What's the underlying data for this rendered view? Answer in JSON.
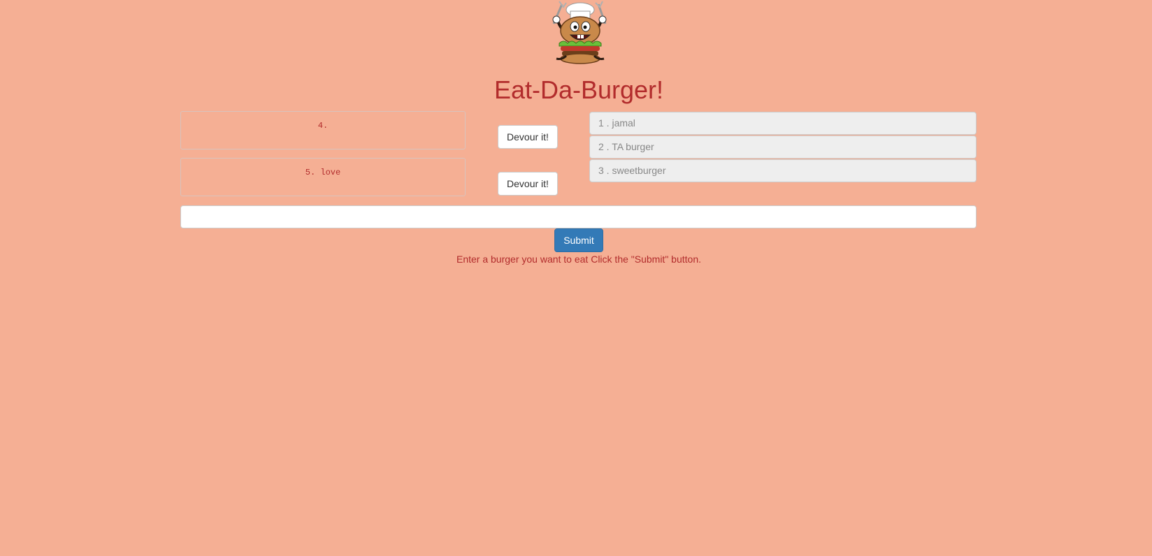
{
  "header": {
    "logo_icon": "burger-chef-mascot-icon",
    "title": "Eat-Da-Burger!"
  },
  "uneaten": [
    {
      "text": "4.",
      "button": "Devour it!"
    },
    {
      "text": "5. love",
      "button": "Devour it!"
    }
  ],
  "eaten": [
    {
      "text": "1 . jamal"
    },
    {
      "text": "2 . TA burger"
    },
    {
      "text": "3 . sweetburger"
    }
  ],
  "form": {
    "input_value": "",
    "input_placeholder": "",
    "submit_label": "Submit",
    "instructions": "Enter a burger you want to eat Click the \"Submit\" button."
  },
  "colors": {
    "background": "#f5af94",
    "accent_text": "#b22c2c",
    "submit_button": "#337ab7"
  }
}
